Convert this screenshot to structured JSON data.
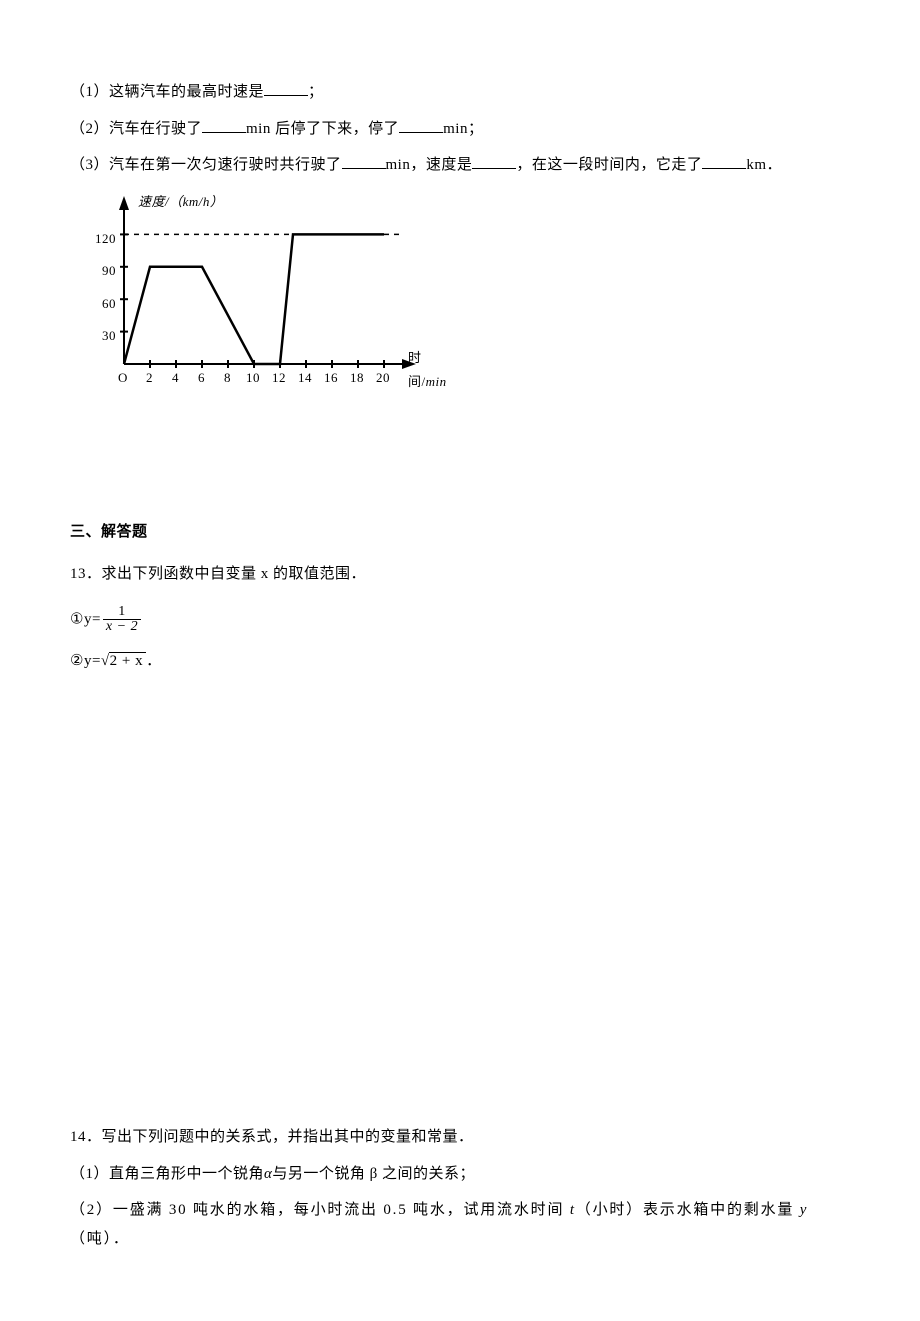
{
  "q12": {
    "line1_pre": "（1）这辆汽车的最高时速是",
    "line1_post": "；",
    "line2_pre": "（2）汽车在行驶了",
    "line2_mid1": "min 后停了下来，停了",
    "line2_post": "min；",
    "line3_pre": "（3）汽车在第一次匀速行驶时共行驶了",
    "line3_mid1": "min，速度是",
    "line3_mid2": "，在这一段时间内，它走了",
    "line3_post": "km．"
  },
  "section3_title": "三、解答题",
  "q13": {
    "stem": "13．求出下列函数中自变量 x 的取值范围．",
    "item1_prefix": "①y=",
    "frac_num": "1",
    "frac_den": "x − 2",
    "item2_prefix": "②y=",
    "radicand": "2 + x",
    "item2_suffix": "．"
  },
  "q14": {
    "stem": "14．写出下列问题中的关系式，并指出其中的变量和常量．",
    "line1_a": "（1）直角三角形中一个锐角",
    "line1_alpha": "α",
    "line1_b": "与另一个锐角 ",
    "line1_beta": "β",
    "line1_c": " 之间的关系；",
    "line2_a": "（2）一盛满 30 吨水的水箱，每小时流出 0.5 吨水，试用流水时间 ",
    "line2_t": "t",
    "line2_b": "（小时）表示水箱中的剩水量 ",
    "line2_y": "y",
    "line2_c": "（吨）．"
  },
  "chart": {
    "y_label_text": "速度/",
    "y_label_unit_a": "（",
    "y_label_unit_b": "km/h",
    "y_label_unit_c": "）",
    "x_label_text": "时间/",
    "x_label_unit": "min",
    "y_ticks": [
      "30",
      "60",
      "90",
      "120"
    ],
    "x_ticks": [
      "0",
      "2",
      "4",
      "6",
      "8",
      "10",
      "12",
      "14",
      "16",
      "18",
      "20"
    ],
    "origin_label": "O"
  },
  "chart_data": {
    "type": "line",
    "title": "",
    "xlabel": "时间/min",
    "ylabel": "速度/(km/h)",
    "ylim": [
      0,
      130
    ],
    "xlim": [
      0,
      20
    ],
    "dashed_reference_y": 120,
    "series": [
      {
        "name": "speed",
        "x": [
          0,
          2,
          6,
          10,
          12,
          13,
          20
        ],
        "y": [
          0,
          90,
          90,
          0,
          0,
          120,
          120
        ]
      }
    ]
  }
}
